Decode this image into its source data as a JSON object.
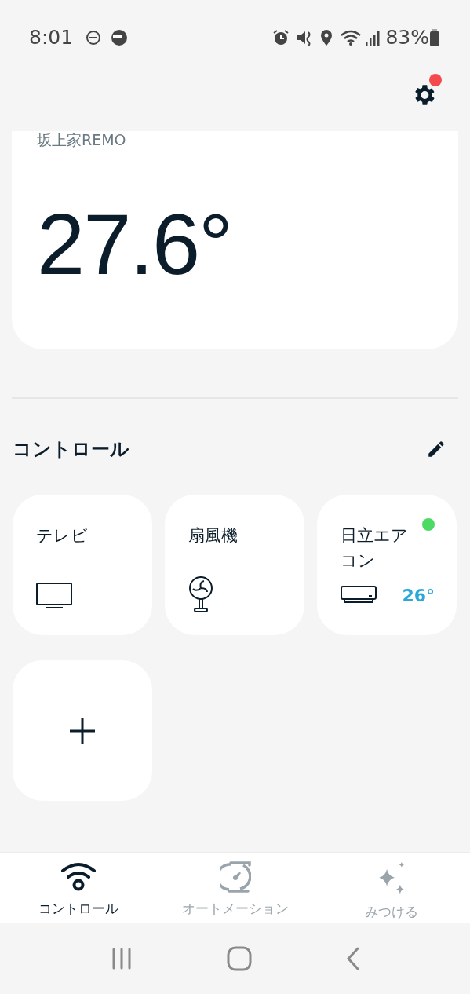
{
  "status_bar": {
    "time": "8:01",
    "battery": "83%"
  },
  "header": {
    "settings_badge": true
  },
  "home_card": {
    "name": "坂上家REMO",
    "temperature": "27.6°"
  },
  "controls": {
    "title": "コントロール",
    "tiles": [
      {
        "kind": "tv",
        "name": "テレビ",
        "on": false
      },
      {
        "kind": "fan",
        "name": "扇風機",
        "on": false
      },
      {
        "kind": "aircon",
        "name": "日立エアコン",
        "on": true,
        "setting": "26°"
      }
    ]
  },
  "bottom_nav": [
    {
      "kind": "control",
      "label": "コントロール",
      "selected": true
    },
    {
      "kind": "automation",
      "label": "オートメーション",
      "selected": false
    },
    {
      "kind": "discover",
      "label": "みつける",
      "selected": false
    }
  ]
}
